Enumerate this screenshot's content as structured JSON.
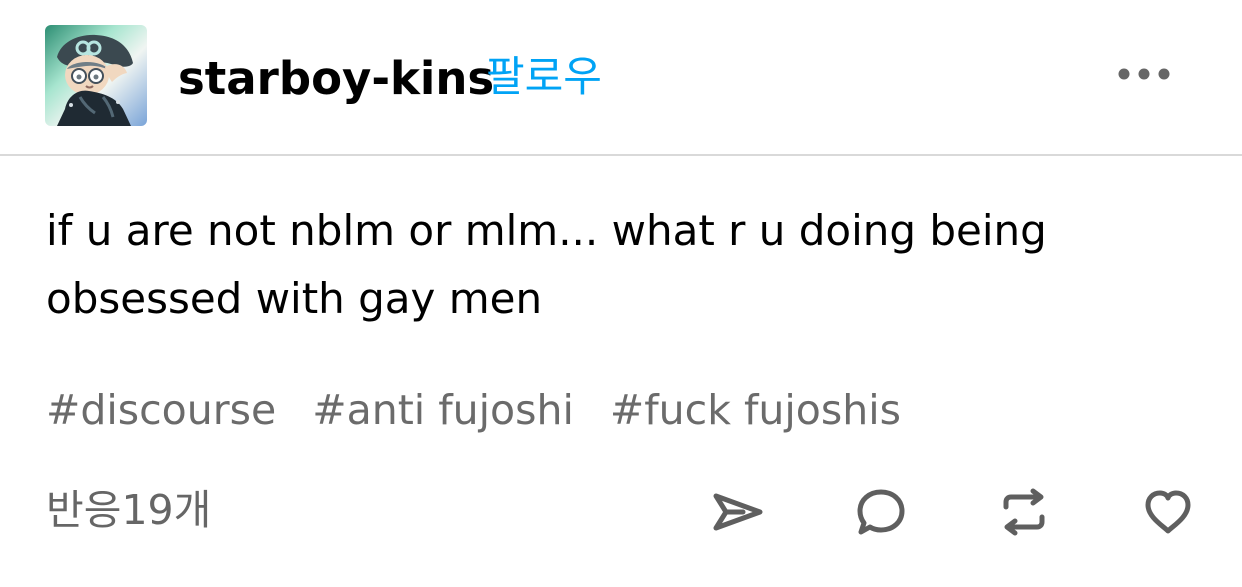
{
  "post": {
    "author": {
      "username": "starboy-kins",
      "avatar_icon": "character-avatar"
    },
    "follow_label": "팔로우",
    "more_icon": "more-dots-icon",
    "body_lines": [
      "if u are not nblm or mlm... what r u doing being",
      "obsessed with gay men"
    ],
    "tags": [
      "#discourse",
      "#anti fujoshi",
      "#fuck fujoshis"
    ],
    "notes_label": "반응19개",
    "actions": {
      "share_icon": "share-icon",
      "reply_icon": "reply-icon",
      "reblog_icon": "reblog-icon",
      "like_icon": "heart-icon"
    }
  },
  "colors": {
    "accent": "#00a3f5",
    "tag_text": "#6b6b6b",
    "divider": "#d9d9d9",
    "icon": "#5f5f5f"
  }
}
